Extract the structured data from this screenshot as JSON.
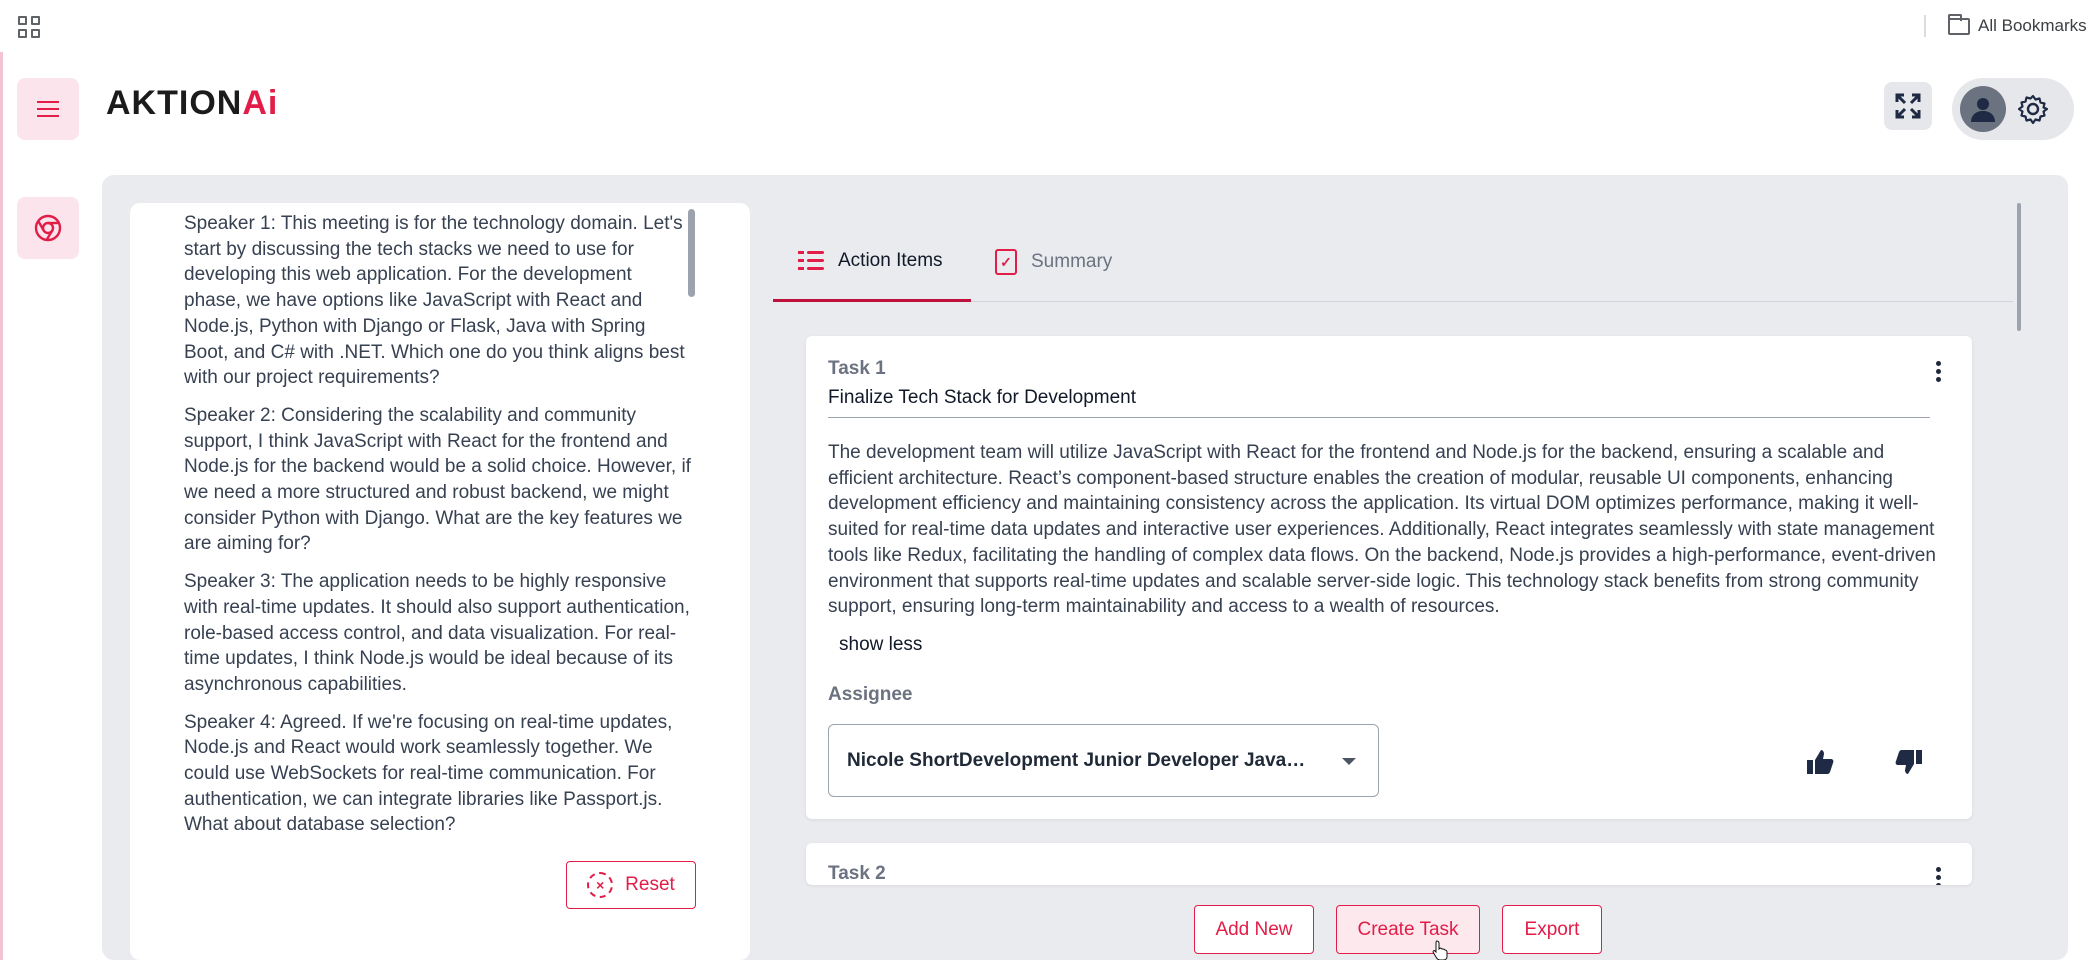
{
  "browser": {
    "all_bookmarks": "All Bookmarks"
  },
  "header": {
    "logo_main": "AKTION",
    "logo_accent": "Ai"
  },
  "transcript": [
    "Speaker 1: This meeting is for the technology domain. Let's start by discussing the tech stacks we need to use for developing this web application. For the development phase, we have options like JavaScript with React and Node.js, Python with Django or Flask, Java with Spring Boot, and C# with .NET. Which one do you think aligns best with our project requirements?",
    "Speaker 2: Considering the scalability and community support, I think JavaScript with React for the frontend and Node.js for the backend would be a solid choice. However, if we need a more structured and robust backend, we might consider Python with Django. What are the key features we are aiming for?",
    "Speaker 3: The application needs to be highly responsive with real-time updates. It should also support authentication, role-based access control, and data visualization. For real-time updates, I think Node.js would be ideal because of its asynchronous capabilities.",
    "Speaker 4: Agreed. If we're focusing on real-time updates, Node.js and React would work seamlessly together. We could use WebSockets for real-time communication. For authentication, we can integrate libraries like Passport.js. What about database selection?"
  ],
  "reset_label": "Reset",
  "tabs": {
    "action_items": "Action Items",
    "summary": "Summary"
  },
  "task1": {
    "label": "Task 1",
    "title": "Finalize Tech Stack for Development",
    "description": "The development team will utilize JavaScript with React for the frontend and Node.js for the backend, ensuring a scalable and efficient architecture. React’s component-based structure enables the creation of modular, reusable UI components, enhancing development efficiency and maintaining consistency across the application. Its virtual DOM optimizes performance, making it well-suited for real-time data updates and interactive user experiences. Additionally, React integrates seamlessly with state management tools like Redux, facilitating the handling of complex data flows. On the backend, Node.js provides a high-performance, event-driven environment that supports real-time updates and scalable server-side logic. This technology stack benefits from strong community support, ensuring long-term maintainability and access to a wealth of resources.",
    "show_less": "show less",
    "assignee_label": "Assignee",
    "assignee_value": "Nicole ShortDevelopment Junior Developer JavaScript, React, Node.js"
  },
  "task2": {
    "label": "Task 2"
  },
  "actions": {
    "add_new": "Add New",
    "create_task": "Create Task",
    "export": "Export"
  },
  "colors": {
    "accent": "#e11d48",
    "panel_bg": "#e9ebef"
  }
}
